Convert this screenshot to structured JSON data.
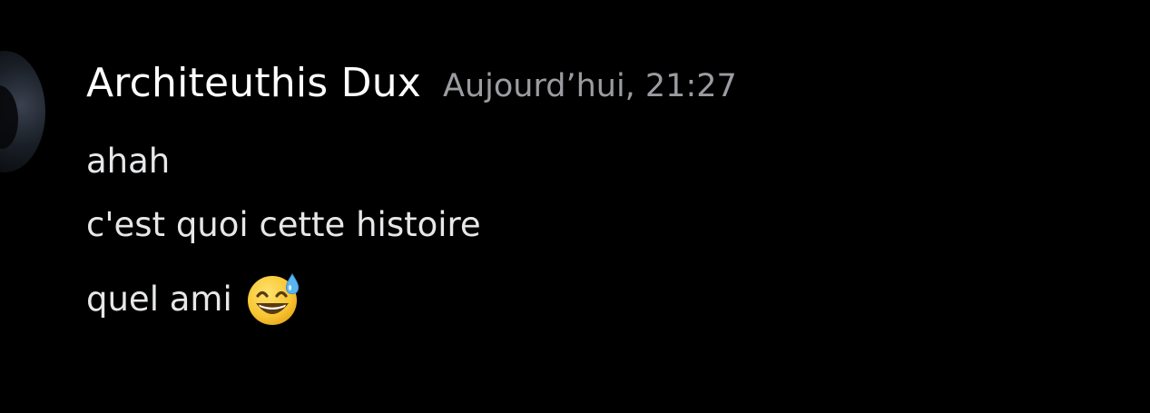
{
  "message": {
    "author": "Architeuthis Dux",
    "timestamp": "Aujourd’hui, 21:27",
    "lines": [
      "ahah",
      "c'est quoi cette histoire",
      "quel ami"
    ],
    "emoji": "grinning-face-with-sweat-icon"
  },
  "colors": {
    "background": "#000000",
    "username": "#ffffff",
    "timestamp": "#9a9ca1",
    "text": "#e6e7e9"
  }
}
